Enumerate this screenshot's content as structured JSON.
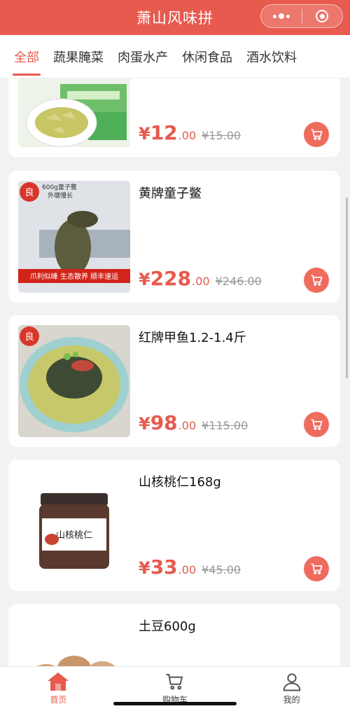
{
  "app": {
    "title": "萧山风味拼"
  },
  "tabs": [
    {
      "label": "全部",
      "active": true
    },
    {
      "label": "蔬果腌菜",
      "active": false
    },
    {
      "label": "肉蛋水产",
      "active": false
    },
    {
      "label": "休闲食品",
      "active": false
    },
    {
      "label": "酒水饮料",
      "active": false
    }
  ],
  "products": [
    {
      "name": "",
      "currency": "¥",
      "price_int": "12",
      "price_dec": ".00",
      "original": "¥15.00"
    },
    {
      "name": "黄牌童子鳖",
      "currency": "¥",
      "price_int": "228",
      "price_dec": ".00",
      "original": "¥246.00",
      "image_text": {
        "tag1": "600g童子鳖",
        "tag2": "外塘慢长",
        "banner": "爪利似峰 生态散养 顺丰速运"
      }
    },
    {
      "name": "红牌甲鱼1.2-1.4斤",
      "currency": "¥",
      "price_int": "98",
      "price_dec": ".00",
      "original": "¥115.00"
    },
    {
      "name": "山核桃仁168g",
      "currency": "¥",
      "price_int": "33",
      "price_dec": ".00",
      "original": "¥45.00",
      "image_text": {
        "jar_label": "山核桃仁"
      }
    },
    {
      "name": "土豆600g",
      "currency": "¥",
      "price_int": "",
      "price_dec": "",
      "original": ""
    }
  ],
  "bottom_nav": [
    {
      "label": "首页",
      "icon": "home-icon",
      "active": true
    },
    {
      "label": "购物车",
      "icon": "cart-icon",
      "active": false
    },
    {
      "label": "我的",
      "icon": "user-icon",
      "active": false
    }
  ],
  "colors": {
    "accent": "#e75a4e",
    "cart_button": "#ee6b5e",
    "old_price": "#999999"
  }
}
